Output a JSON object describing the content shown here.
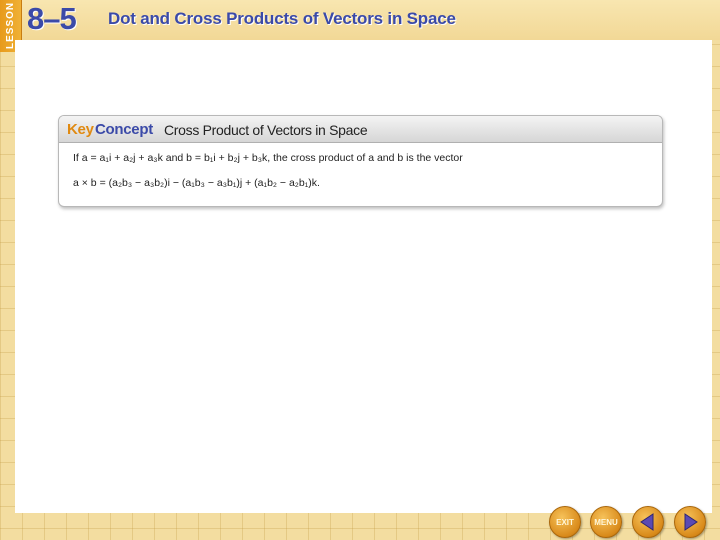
{
  "header": {
    "lesson_word": "LESSON",
    "lesson_number": "8–5",
    "lesson_title": "Dot and Cross Products of Vectors in Space"
  },
  "key_concept": {
    "key_label": "Key",
    "concept_label": "Concept",
    "title": "Cross Product of Vectors in Space",
    "line1": "If a = a₁i + a₂j + a₃k and b = b₁i + b₂j + b₃k, the cross product of a and b is the vector",
    "line2": "a × b = (a₂b₃ − a₃b₂)i − (a₁b₃ − a₃b₁)j + (a₁b₂ − a₂b₁)k."
  },
  "nav": {
    "exit_label": "EXIT",
    "menu_label": "MENU",
    "prev_icon": "triangle-left-icon",
    "next_icon": "triangle-right-icon"
  },
  "colors": {
    "title_blue": "#3b4aa8",
    "accent_orange": "#e08a12",
    "background_yellow": "#f3dda0"
  }
}
